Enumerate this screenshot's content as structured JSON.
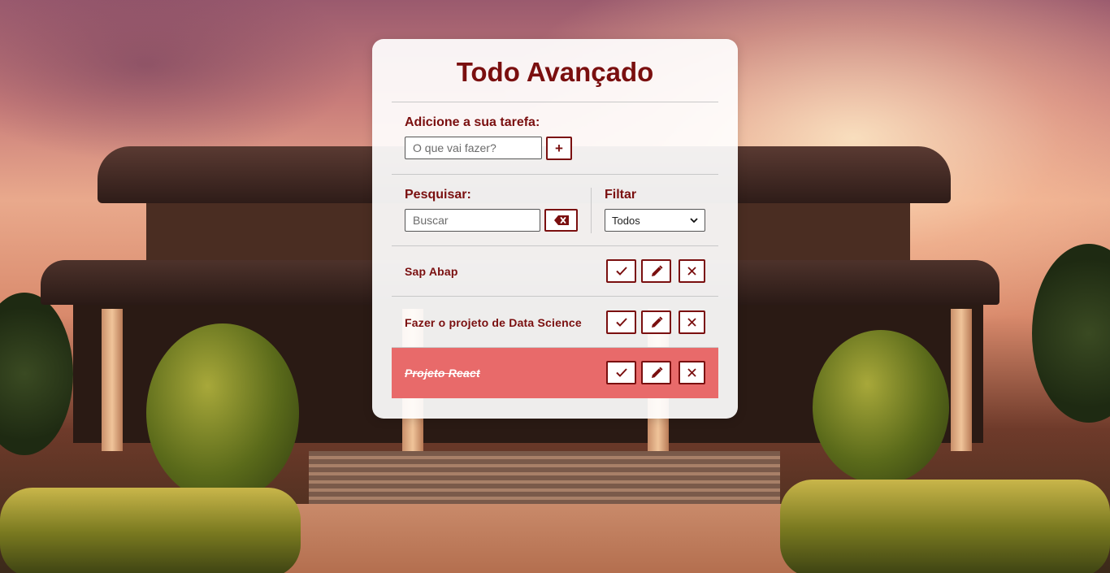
{
  "app": {
    "title": "Todo Avançado"
  },
  "add": {
    "label": "Adicione a sua tarefa:",
    "placeholder": "O que vai fazer?",
    "value": "",
    "button_label": "+"
  },
  "search": {
    "label": "Pesquisar:",
    "placeholder": "Buscar",
    "value": ""
  },
  "filter": {
    "label": "Filtar",
    "selected": "Todos"
  },
  "todos": [
    {
      "text": "Sap Abap",
      "done": false
    },
    {
      "text": "Fazer o projeto de Data Science",
      "done": false
    },
    {
      "text": "Projeto React",
      "done": true
    }
  ],
  "colors": {
    "accent": "#7a0f0f",
    "done_row": "#e86a6a",
    "card_bg": "#ffffff"
  },
  "icons": {
    "add": "plus-icon",
    "clear_search": "backspace-x-icon",
    "filter_dropdown": "chevron-down-icon",
    "finish": "check-icon",
    "edit": "pencil-icon",
    "remove": "x-icon"
  }
}
